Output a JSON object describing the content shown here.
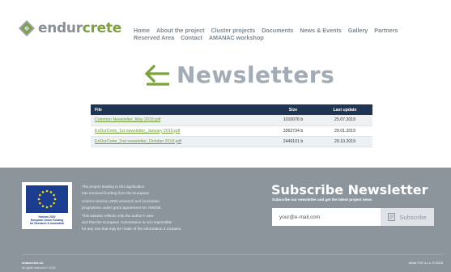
{
  "header": {
    "logo": {
      "text_gray": "endur",
      "text_green": "crete"
    },
    "nav": {
      "row1": [
        "Home",
        "About the project",
        "Cluster projects",
        "Documents",
        "News & Events",
        "Gallery",
        "Partners"
      ],
      "row2": [
        "Reserved Area",
        "Contact",
        "AMANAC workshop"
      ]
    }
  },
  "page": {
    "title": "Newsletters",
    "back_icon": "arrow-left-icon"
  },
  "table": {
    "headers": {
      "file": "File",
      "size": "Size",
      "date": "Last update"
    },
    "rows": [
      {
        "file": "Common Newsletter_May 2019.pdf",
        "size": "1010076 b",
        "date": "25.07.2019"
      },
      {
        "file": "EnDurCrete_1st newsletter_January 2019.pdf",
        "size": "3362734 b",
        "date": "29.01.2019"
      },
      {
        "file": "EnDurCrete_2nd newsletter_October 2019.pdf",
        "size": "2449101 b",
        "date": "29.10.2019"
      }
    ]
  },
  "footer": {
    "eu_caption": [
      "Horizon 2020",
      "European Union Funding",
      "for Research & Innovation"
    ],
    "funding_paragraphs": [
      [
        "The project leading to this application",
        "has received funding from the European"
      ],
      [
        "Union's Horizon 2020 research and innovation",
        "programme under grant agreement No 760639."
      ],
      [
        "This website reflects only the author's view",
        "and that the European Commission is not responsible",
        "for any use that may be made of the information it contains."
      ]
    ],
    "subscribe": {
      "title": "Subscribe Newsletter",
      "description": "Subscribe our newsletter and get the latest project news",
      "email_placeholder": "your@e-mail.com",
      "button_label": "Subscribe"
    },
    "site": "endurcrete.eu",
    "rights": "All rights reserved © 2018",
    "credit": "Allots TNT s.r.o. © 2018"
  },
  "colors": {
    "brand_green": "#7aa23a",
    "table_header": "#1f3553",
    "footer_bg": "#8c949c",
    "title_gray": "#a2acb6"
  }
}
